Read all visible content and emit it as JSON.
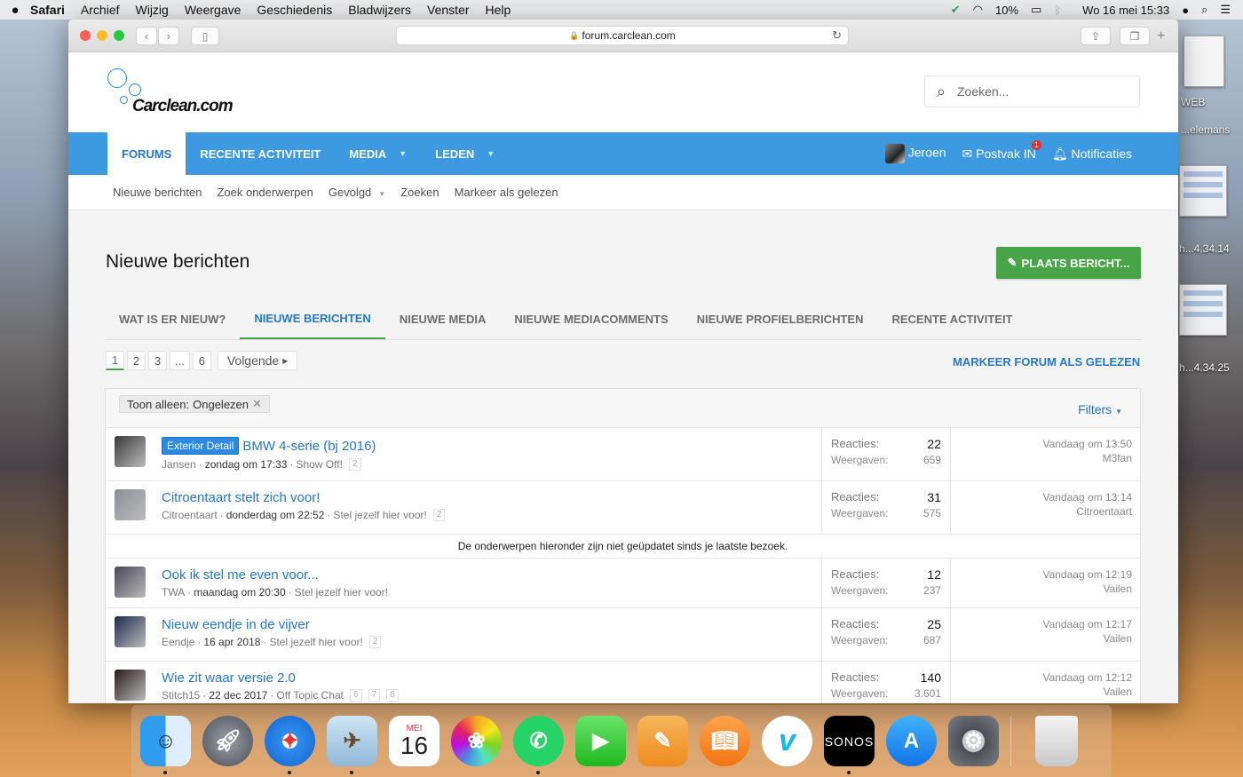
{
  "menubar": {
    "apple": "",
    "app": "Safari",
    "items": [
      "Archief",
      "Wijzig",
      "Weergave",
      "Geschiedenis",
      "Bladwijzers",
      "Venster",
      "Help"
    ],
    "battery": "10%",
    "datetime": "Wo 16 mei  15:33"
  },
  "desktop": {
    "label1": "WEB",
    "label2": "...elemans",
    "label3": "h...4.34.14",
    "label4": "h...4.34.25"
  },
  "browser": {
    "url": "forum.carclean.com",
    "lock": "🔒"
  },
  "site": {
    "logo": "Carclean.com",
    "search_placeholder": "Zoeken..."
  },
  "nav": {
    "tabs": [
      "FORUMS",
      "RECENTE ACTIVITEIT",
      "MEDIA",
      "LEDEN"
    ],
    "user": "Jeroen",
    "inbox": "Postvak IN",
    "inbox_badge": "1",
    "notifications": "Notificaties"
  },
  "subnav": [
    "Nieuwe berichten",
    "Zoek onderwerpen",
    "Gevolgd",
    "Zoeken",
    "Markeer als gelezen"
  ],
  "page": {
    "title": "Nieuwe berichten",
    "post_button": "PLAATS BERICHT...",
    "tabs": [
      "WAT IS ER NIEUW?",
      "NIEUWE BERICHTEN",
      "NIEUWE MEDIA",
      "NIEUWE MEDIACOMMENTS",
      "NIEUWE PROFIELBERICHTEN",
      "RECENTE ACTIVITEIT"
    ],
    "mark_forum": "MARKEER FORUM ALS GELEZEN"
  },
  "pager": {
    "pages": [
      "1",
      "2",
      "3",
      "...",
      "6"
    ],
    "next": "Volgende"
  },
  "filter": {
    "chip_label": "Toon alleen:",
    "chip_value": "Ongelezen",
    "filters": "Filters"
  },
  "labels": {
    "replies": "Reacties:",
    "views": "Weergaven:"
  },
  "divider_text": "De onderwerpen hieronder zijn niet geüpdatet sinds je laatste bezoek.",
  "threads": [
    {
      "prefix": "Exterior Detail",
      "title": "BMW 4-serie (bj 2016)",
      "author": "Jansen",
      "date": "zondag om 17:33",
      "forum": "Show Off!",
      "pages": [
        "2"
      ],
      "replies": "22",
      "views": "659",
      "last_date": "Vandaag om 13:50",
      "last_user": "M3fan",
      "avatar_color": "#3a3a3a"
    },
    {
      "prefix": "",
      "title": "Citroentaart stelt zich voor!",
      "author": "Citroentaart",
      "date": "donderdag om 22:52",
      "forum": "Stel jezelf hier voor!",
      "pages": [
        "2"
      ],
      "replies": "31",
      "views": "575",
      "last_date": "Vandaag om 13:14",
      "last_user": "Citroentaart",
      "avatar_color": "#8a9098"
    },
    {
      "prefix": "",
      "title": "Ook ik stel me even voor...",
      "author": "TWA",
      "date": "maandag om 20:30",
      "forum": "Stel jezelf hier voor!",
      "pages": [],
      "replies": "12",
      "views": "237",
      "last_date": "Vandaag om 12:19",
      "last_user": "Vailen",
      "avatar_color": "#4a4658"
    },
    {
      "prefix": "",
      "title": "Nieuw eendje in de vijver",
      "author": "Eendje",
      "date": "16 apr 2018",
      "forum": "Stel jezelf hier voor!",
      "pages": [
        "2"
      ],
      "replies": "25",
      "views": "687",
      "last_date": "Vandaag om 12:17",
      "last_user": "Vailen",
      "avatar_color": "#1c2a4e"
    },
    {
      "prefix": "",
      "title": "Wie zit waar versie 2.0",
      "author": "Stitch15",
      "date": "22 dec 2017",
      "forum": "Off Topic Chat",
      "pages": [
        "6",
        "7",
        "8"
      ],
      "replies": "140",
      "views": "3.601",
      "last_date": "Vandaag om 12:12",
      "last_user": "Vailen",
      "avatar_color": "#2a1a1a"
    }
  ],
  "dock": [
    "Finder",
    "Launchpad",
    "Safari",
    "Preview",
    "Agenda",
    "Foto's",
    "WhatsApp",
    "FaceTime",
    "Pages",
    "iBooks",
    "Vimeo",
    "SONOS",
    "App Store",
    "Systeemvoorkeuren",
    "Prullenmand"
  ],
  "calendar": {
    "month": "MEI",
    "day": "16"
  }
}
